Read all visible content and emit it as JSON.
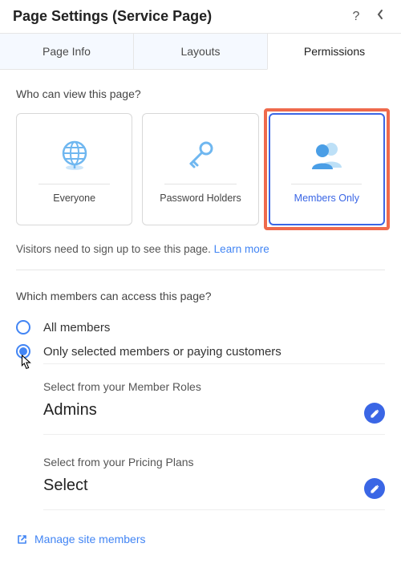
{
  "header": {
    "title": "Page Settings (Service Page)"
  },
  "tabs": {
    "page_info": "Page Info",
    "layouts": "Layouts",
    "permissions": "Permissions"
  },
  "view_section": {
    "question": "Who can view this page?",
    "cards": {
      "everyone": "Everyone",
      "password_holders": "Password Holders",
      "members_only": "Members Only"
    },
    "hint_text": "Visitors need to sign up to see this page. ",
    "hint_link": "Learn more"
  },
  "access_section": {
    "question": "Which members can access this page?",
    "option_all": "All members",
    "option_selected": "Only selected members or paying customers",
    "roles_caption": "Select from your Member Roles",
    "roles_value": "Admins",
    "plans_caption": "Select from your Pricing Plans",
    "plans_value": "Select",
    "manage_link": "Manage site members"
  },
  "colors": {
    "accent": "#3a66e5",
    "link": "#4285f4",
    "highlight": "#ef6a4c"
  }
}
